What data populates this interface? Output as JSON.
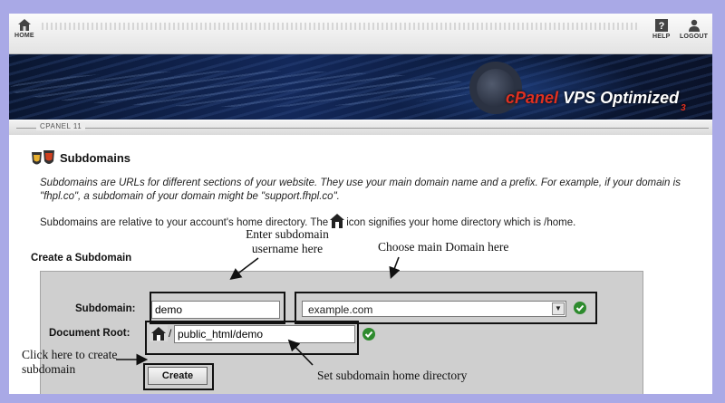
{
  "nav": {
    "home_label": "HOME",
    "help_label": "HELP",
    "logout_label": "LOGOUT"
  },
  "banner": {
    "brand_c": "c",
    "brand_panel": "Panel",
    "brand_rest": "VPS Optimized",
    "brand_version": "3"
  },
  "cpanel_tag": "CPANEL 11",
  "page": {
    "title": "Subdomains",
    "description": "Subdomains are URLs for different sections of your website. They use your main domain name and a prefix. For example, if your domain is \"fhpl.co\", a subdomain of your domain might be \"support.fhpl.co\".",
    "home_note_before": "Subdomains are relative to your account's home directory. The",
    "home_note_after": "icon signifies your home directory which is /home.",
    "create_heading": "Create a Subdomain"
  },
  "form": {
    "subdomain_label": "Subdomain:",
    "subdomain_value": "demo",
    "domain_selected": "example.com",
    "docroot_label": "Document Root:",
    "docroot_slash": "/",
    "docroot_value": "public_html/demo",
    "create_label": "Create"
  },
  "annotations": {
    "enter_subdomain": "Enter subdomain username here",
    "choose_domain": "Choose main Domain here",
    "click_here": "Click here to create subdomain",
    "set_home": "Set subdomain home directory"
  },
  "colors": {
    "background": "#a9a9e6",
    "panel": "#cfcfcf",
    "ok_green": "#2e8b2e",
    "brand_red": "#e03020"
  }
}
